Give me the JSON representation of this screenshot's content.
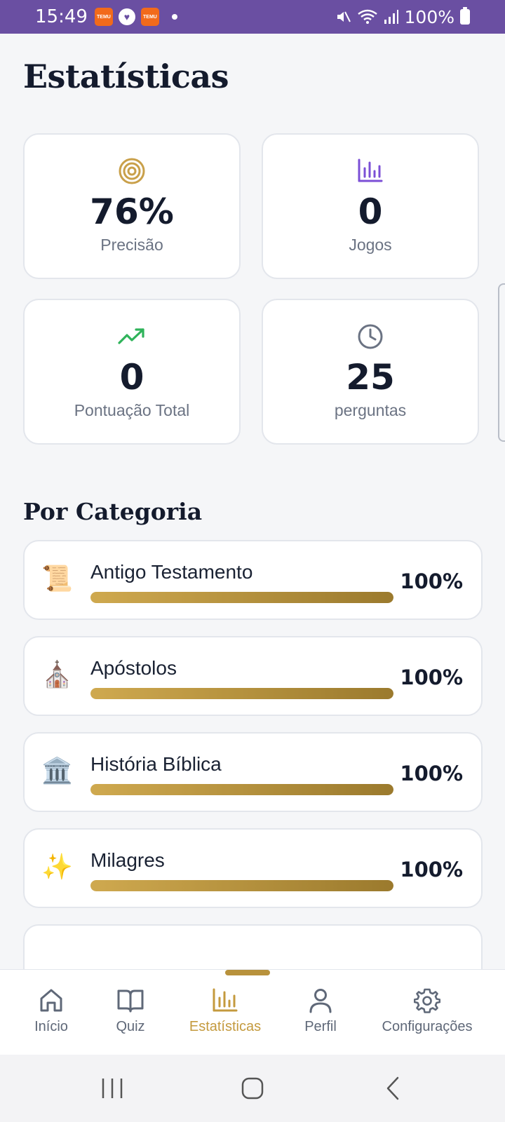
{
  "status_bar": {
    "time": "15:49",
    "notification_icons": [
      "temu-icon",
      "heart-app-icon",
      "temu-icon"
    ],
    "temu_label": "TEMU",
    "battery_text": "100%"
  },
  "page": {
    "title": "Estatísticas"
  },
  "stats": [
    {
      "icon": "target-icon",
      "value": "76%",
      "label": "Precisão",
      "color": "#c9a04a"
    },
    {
      "icon": "bar-chart-icon",
      "value": "0",
      "label": "Jogos",
      "color": "#7b4fd6"
    },
    {
      "icon": "trending-up-icon",
      "value": "0",
      "label": "Pontuação Total",
      "color": "#2fb35a"
    },
    {
      "icon": "clock-icon",
      "value": "25",
      "label": "perguntas",
      "color": "#6b7383"
    }
  ],
  "categories_section": {
    "title": "Por Categoria",
    "items": [
      {
        "emoji": "📜",
        "name": "Antigo Testamento",
        "percent": "100%",
        "progress": 1.0
      },
      {
        "emoji": "⛪",
        "name": "Apóstolos",
        "percent": "100%",
        "progress": 1.0
      },
      {
        "emoji": "🏛️",
        "name": "História Bíblica",
        "percent": "100%",
        "progress": 1.0
      },
      {
        "emoji": "✨",
        "name": "Milagres",
        "percent": "100%",
        "progress": 1.0
      }
    ]
  },
  "bottom_nav": {
    "items": [
      {
        "label": "Início",
        "icon": "home-icon",
        "active": false
      },
      {
        "label": "Quiz",
        "icon": "book-icon",
        "active": false
      },
      {
        "label": "Estatísticas",
        "icon": "bar-chart-icon",
        "active": true
      },
      {
        "label": "Perfil",
        "icon": "user-icon",
        "active": false
      },
      {
        "label": "Configurações",
        "icon": "gear-icon",
        "active": false
      }
    ],
    "active_color": "#c49a3e"
  },
  "system_nav": {
    "buttons": [
      "recents-icon",
      "home-circle-icon",
      "back-icon"
    ]
  }
}
